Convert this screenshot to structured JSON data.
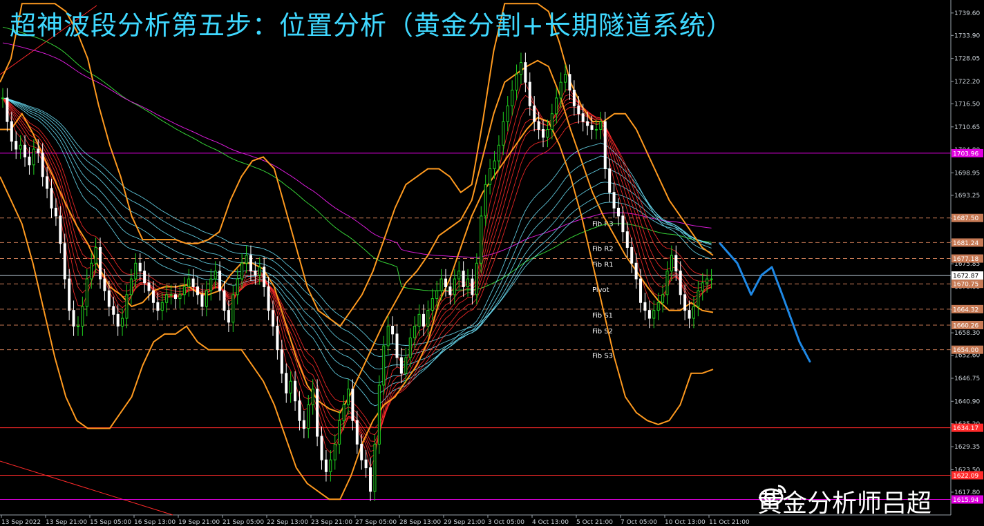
{
  "title": "超神波段分析第五步：位置分析（黄金分割+长期隧道系统）",
  "watermark": {
    "text": "黄金分析师吕超",
    "icon": "weibo-icon"
  },
  "colors": {
    "background": "#000000",
    "title": "#3fd8ff",
    "bollinger": "#ff9a1f",
    "projection": "#1e88e5",
    "pivot_line": "#c77a55",
    "fib_line": "#ff2a2a",
    "magenta": "#e000e0",
    "ema_red": "#ff2a2a",
    "ema_cyan": "#6ee7ff",
    "ma_green": "#36d236",
    "ma_magenta": "#d81bd8",
    "candle_up": "#1fd21f",
    "candle_down": "#ffffff"
  },
  "chart_data": {
    "type": "candlestick",
    "ylim": [
      1612.0,
      1741.5
    ],
    "y_ticks": [
      1739.6,
      1733.9,
      1728.05,
      1722.2,
      1716.5,
      1710.65,
      1704.8,
      1698.95,
      1693.25,
      1687.4,
      1681.55,
      1675.85,
      1670.0,
      1664.15,
      1658.3,
      1652.6,
      1646.75,
      1640.9,
      1635.2,
      1629.35,
      1623.5,
      1617.8
    ],
    "x_ticks": [
      "13 Sep 2022",
      "13 Sep 21:00",
      "15 Sep 05:00",
      "16 Sep 13:00",
      "19 Sep 21:00",
      "21 Sep 05:00",
      "22 Sep 13:00",
      "23 Sep 21:00",
      "27 Sep 05:00",
      "28 Sep 13:00",
      "29 Sep 21:00",
      "3 Oct 05:00",
      "4 Oct 13:00",
      "5 Oct 21:00",
      "7 Oct 05:00",
      "10 Oct 13:00",
      "11 Oct 21:00"
    ],
    "horizontal_levels": [
      {
        "price": 1703.96,
        "label": "1703.96",
        "style": "solid",
        "color": "#e000e0"
      },
      {
        "price": 1687.5,
        "label": "1687.50",
        "style": "dashed",
        "color": "#c77a55",
        "tag": "Fib R3"
      },
      {
        "price": 1681.24,
        "label": "1681.24",
        "style": "dashed",
        "color": "#c77a55",
        "tag": "Fib R2"
      },
      {
        "price": 1677.18,
        "label": "1677.18",
        "style": "dashed",
        "color": "#c77a55",
        "tag": "Fib R1"
      },
      {
        "price": 1672.87,
        "label": "1672.87",
        "style": "solid",
        "color": "#b9c9d6"
      },
      {
        "price": 1670.75,
        "label": "1670.75",
        "style": "dashed",
        "color": "#c77a55",
        "tag": "Pivot"
      },
      {
        "price": 1664.32,
        "label": "1664.32",
        "style": "dashed",
        "color": "#c77a55",
        "tag": "Fib S1"
      },
      {
        "price": 1660.26,
        "label": "1660.26",
        "style": "dashed",
        "color": "#c77a55",
        "tag": "Fib S2"
      },
      {
        "price": 1654.0,
        "label": "1654.00",
        "style": "dashed",
        "color": "#c77a55",
        "tag": "Fib S3"
      },
      {
        "price": 1634.17,
        "label": "1634.17",
        "style": "solid",
        "color": "#ff2a2a"
      },
      {
        "price": 1622.09,
        "label": "1622.09",
        "style": "solid",
        "color": "#ff2a2a"
      },
      {
        "price": 1615.94,
        "label": "1615.94",
        "style": "solid",
        "color": "#e000e0"
      }
    ],
    "close": [
      1718,
      1712,
      1707,
      1705,
      1706,
      1703,
      1701,
      1705,
      1704,
      1698,
      1695,
      1690,
      1688,
      1681,
      1672,
      1664,
      1660,
      1660,
      1665,
      1672,
      1676,
      1680,
      1672,
      1669,
      1665,
      1663,
      1660,
      1662,
      1668,
      1672,
      1676,
      1674,
      1671,
      1669,
      1666,
      1664,
      1666,
      1668,
      1668,
      1667,
      1668,
      1670,
      1672,
      1670,
      1668,
      1665,
      1669,
      1672,
      1674,
      1669,
      1664,
      1661,
      1668,
      1672,
      1676,
      1678,
      1674,
      1673,
      1675,
      1670,
      1664,
      1660,
      1654,
      1648,
      1643,
      1646,
      1641,
      1636,
      1634,
      1640,
      1644,
      1632,
      1626,
      1623,
      1626,
      1630,
      1636,
      1640,
      1644,
      1636,
      1630,
      1626,
      1624,
      1618,
      1630,
      1645,
      1655,
      1660,
      1658,
      1652,
      1648,
      1652,
      1657,
      1660,
      1663,
      1660,
      1664,
      1667,
      1669,
      1672,
      1670,
      1668,
      1672,
      1674,
      1670,
      1672,
      1668,
      1676,
      1688,
      1696,
      1700,
      1702,
      1706,
      1712,
      1716,
      1720,
      1724,
      1727,
      1722,
      1716,
      1712,
      1710,
      1708,
      1710,
      1714,
      1718,
      1722,
      1724,
      1720,
      1716,
      1714,
      1712,
      1711,
      1710,
      1710,
      1712,
      1700,
      1694,
      1690,
      1688,
      1684,
      1680,
      1676,
      1672,
      1666,
      1664,
      1662,
      1664,
      1666,
      1668,
      1674,
      1678,
      1674,
      1668,
      1664,
      1662,
      1665,
      1669,
      1671,
      1672,
      1672
    ],
    "bollinger": {
      "upper": [
        1722,
        1728,
        1742,
        1742,
        1742,
        1742,
        1740,
        1735,
        1728,
        1716,
        1706,
        1698,
        1688,
        1682,
        1682,
        1682,
        1682,
        1681,
        1681,
        1682,
        1684,
        1692,
        1698,
        1702,
        1703,
        1700,
        1690,
        1680,
        1670,
        1664,
        1662,
        1660,
        1664,
        1668,
        1674,
        1682,
        1690,
        1696,
        1698,
        1700,
        1700,
        1698,
        1694,
        1696,
        1712,
        1730,
        1742,
        1742,
        1742,
        1742,
        1740,
        1732,
        1722,
        1716,
        1712,
        1712,
        1714,
        1714,
        1710,
        1704,
        1698,
        1692,
        1688,
        1684,
        1680,
        1678
      ],
      "lower": [
        1698,
        1692,
        1686,
        1676,
        1664,
        1652,
        1642,
        1636,
        1634,
        1634,
        1634,
        1638,
        1642,
        1650,
        1656,
        1658,
        1658,
        1660,
        1656,
        1654,
        1654,
        1654,
        1654,
        1650,
        1646,
        1640,
        1632,
        1624,
        1620,
        1618,
        1616,
        1616,
        1622,
        1630,
        1636,
        1640,
        1642,
        1646,
        1650,
        1656,
        1666,
        1672,
        1680,
        1688,
        1694,
        1698,
        1702,
        1706,
        1710,
        1713,
        1712,
        1706,
        1698,
        1688,
        1676,
        1664,
        1652,
        1642,
        1638,
        1636,
        1635,
        1636,
        1640,
        1648,
        1648,
        1649
      ]
    },
    "projection_path": [
      [
        0,
        1681
      ],
      [
        0.25,
        1676
      ],
      [
        0.45,
        1668
      ],
      [
        0.6,
        1673
      ],
      [
        0.75,
        1675
      ],
      [
        0.9,
        1668
      ],
      [
        1.15,
        1656
      ],
      [
        1.3,
        1651
      ]
    ],
    "series": [
      {
        "name": "ema_red",
        "type": "ribbon"
      },
      {
        "name": "ema_cyan",
        "type": "ribbon"
      },
      {
        "name": "ma_green",
        "type": "line"
      },
      {
        "name": "ma_magenta",
        "type": "line"
      }
    ]
  }
}
